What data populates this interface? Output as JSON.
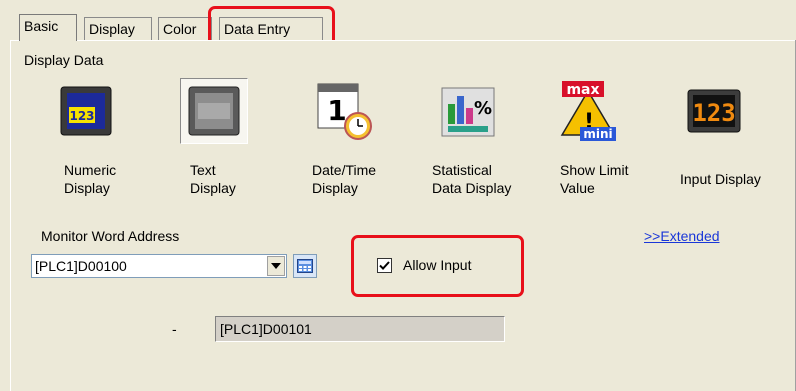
{
  "tabs": [
    {
      "label": "Basic",
      "active": true
    },
    {
      "label": "Display",
      "active": false
    },
    {
      "label": "Color",
      "active": false
    },
    {
      "label": "Data Entry",
      "active": false,
      "highlighted": true
    }
  ],
  "display_data": {
    "section_label": "Display Data",
    "items": [
      {
        "line1": "Numeric",
        "line2": "Display",
        "icon": "numeric-display-icon",
        "selected": false
      },
      {
        "line1": "Text",
        "line2": "Display",
        "icon": "text-display-icon",
        "selected": true
      },
      {
        "line1": "Date/Time",
        "line2": "Display",
        "icon": "date-time-display-icon",
        "selected": false
      },
      {
        "line1": "Statistical",
        "line2": "Data Display",
        "icon": "statistical-data-display-icon",
        "selected": false
      },
      {
        "line1": "Show Limit",
        "line2": "Value",
        "icon": "show-limit-value-icon",
        "selected": false
      },
      {
        "line1": "Input Display",
        "line2": "",
        "icon": "input-display-icon",
        "selected": false
      }
    ],
    "icon_text": {
      "numeric": "123",
      "date": "1",
      "stats": "%",
      "max": "max",
      "mini": "mini",
      "warn": "!",
      "input": "123"
    }
  },
  "monitor": {
    "label": "Monitor Word Address",
    "value": "[PLC1]D00100",
    "extended_link": ">>Extended",
    "allow_input_label": "Allow Input",
    "allow_input_checked": true,
    "dash": "-",
    "input_address": "[PLC1]D00101"
  },
  "colors": {
    "highlight": "#e8101a",
    "link": "#1a37d8",
    "background": "#ece9d8"
  }
}
